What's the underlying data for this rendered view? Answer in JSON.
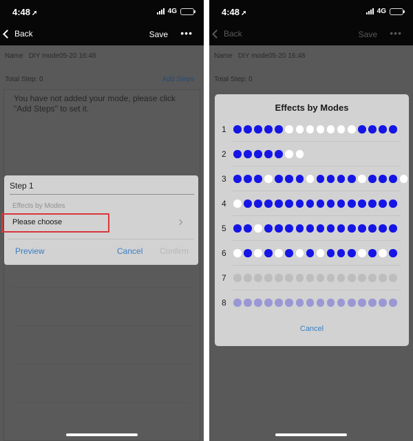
{
  "status_bar": {
    "time": "4:48",
    "location_glyph": "➚",
    "network": "4G"
  },
  "left_screen": {
    "nav": {
      "back_label": "Back",
      "save_label": "Save",
      "more_label": "•••"
    },
    "name_label": "Name",
    "name_value": "DIY mode05-20 16:48",
    "total_step": "Total Step: 0",
    "add_steps": "Add Steps",
    "hint": "You have not added your mode, please click \"Add Steps\" to set it.",
    "step_dialog": {
      "title": "Step 1",
      "effects_label": "Effects by Modes",
      "choose_placeholder": "Please choose",
      "preview": "Preview",
      "cancel": "Cancel",
      "confirm": "Confirm"
    }
  },
  "right_screen": {
    "nav": {
      "back_label": "Back",
      "save_label": "Save",
      "more_label": "•••"
    },
    "name_label": "Name",
    "name_value": "DIY mode05-20 16:48",
    "total_step": "Total Step: 0",
    "effects_dialog": {
      "title": "Effects by Modes",
      "cancel": "Cancel",
      "modes": [
        {
          "number": "1",
          "dots": "bbbbbwwwwwwwbbbb"
        },
        {
          "number": "2",
          "dots": "bbbbbww"
        },
        {
          "number": "3",
          "dots": "bbbwbbbwbbbbwbbbw"
        },
        {
          "number": "4",
          "dots": "wbbbbbbbbbbbbbbb"
        },
        {
          "number": "5",
          "dots": "bbwbbbbbbbbbbbbb"
        },
        {
          "number": "6",
          "dots": "wbwbwbwbwbbbwbwb"
        },
        {
          "number": "7",
          "dots": "gggggggggggggggg"
        },
        {
          "number": "8",
          "dots": "pppppppppppppppp"
        }
      ]
    }
  },
  "colors": {
    "accent_blue": "#3a7fc4",
    "dot_blue": "#1515e6",
    "dot_white": "#ffffff",
    "dot_gray": "#bdbdbd",
    "dot_purple": "#9a98d4",
    "highlight_red": "#d9343a"
  },
  "icons": [
    "location-arrow-icon",
    "signal-bars-icon",
    "battery-icon",
    "back-chevron-icon",
    "more-dots-icon",
    "chevron-right-icon"
  ]
}
